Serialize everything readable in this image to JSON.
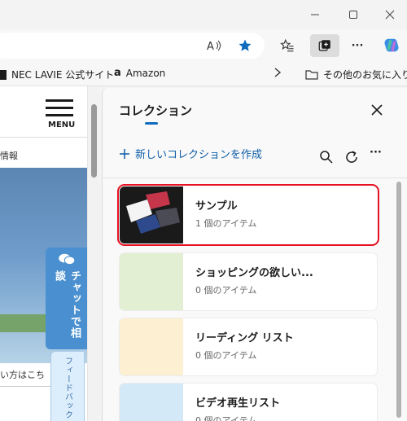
{
  "toolbar": {
    "read_aloud_label": "A",
    "more_label": "···"
  },
  "favorites": [
    {
      "label": "NEC LAVIE 公式サイト"
    },
    {
      "label": "Amazon"
    }
  ],
  "favorites_other": "その他のお気に入り",
  "webpage": {
    "menu_label": "MENU",
    "text_top": "情報",
    "chat_label": "チャットで相談",
    "bottom_text": "い方はこち",
    "feedback_label": "フィードバック"
  },
  "collections": {
    "title": "コレクション",
    "new_collection": "新しいコレクションを作成",
    "more_label": "···",
    "items": [
      {
        "name": "サンプル",
        "count": "1 個のアイテム",
        "thumb_color": "#1a1a1a",
        "selected": true
      },
      {
        "name": "ショッピングの欲しい...",
        "count": "0 個のアイテム",
        "thumb_color": "#e3efd2"
      },
      {
        "name": "リーディング リスト",
        "count": "0 個のアイテム",
        "thumb_color": "#fdf0d2"
      },
      {
        "name": "ビデオ再生リスト",
        "count": "0 個のアイテム",
        "thumb_color": "#d4e9f7"
      }
    ]
  },
  "colors": {
    "accent": "#0f6cbd",
    "selection_border": "#e81123",
    "star": "#0f6cbd"
  }
}
